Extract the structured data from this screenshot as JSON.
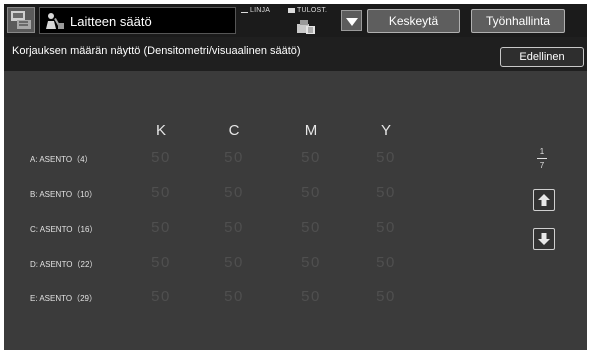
{
  "header": {
    "title": "Laitteen säätö",
    "line_label": "LINJA",
    "print_label": "TULOST.",
    "pause_label": "Keskeytä",
    "jobs_label": "Työnhallinta"
  },
  "subheader": {
    "title": "Korjauksen määrän näyttö (Densitometri/visuaalinen säätö)",
    "back_label": "Edellinen"
  },
  "table": {
    "columns": [
      "K",
      "C",
      "M",
      "Y"
    ],
    "rows": [
      {
        "label": "A: ASENTO（4）",
        "values": [
          "50",
          "50",
          "50",
          "50"
        ]
      },
      {
        "label": "B: ASENTO（10）",
        "values": [
          "50",
          "50",
          "50",
          "50"
        ]
      },
      {
        "label": "C: ASENTO（16）",
        "values": [
          "50",
          "50",
          "50",
          "50"
        ]
      },
      {
        "label": "D: ASENTO（22）",
        "values": [
          "50",
          "50",
          "50",
          "50"
        ]
      },
      {
        "label": "E: ASENTO（29）",
        "values": [
          "50",
          "50",
          "50",
          "50"
        ]
      }
    ]
  },
  "pager": {
    "current": "1",
    "total": "7"
  },
  "icons": {
    "app": "machine-settings-icon",
    "title": "technician-icon",
    "printer": "printer-icon",
    "dropdown": "triangle-down-icon",
    "up": "arrow-up-icon",
    "down": "arrow-down-icon"
  },
  "colors": {
    "background": "#3b3b3b",
    "topbar": "#1b1b1b",
    "value_text": "#4f4f4f"
  }
}
